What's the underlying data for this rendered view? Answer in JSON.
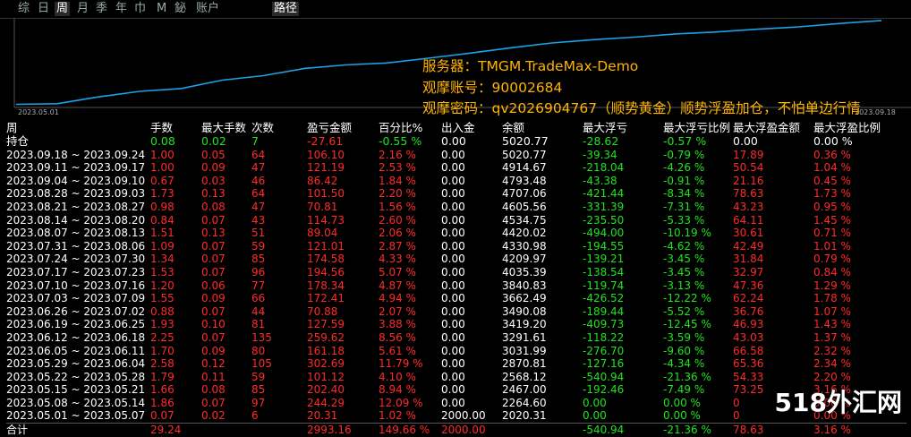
{
  "tabs": [
    {
      "label": "综",
      "active": false
    },
    {
      "label": "日",
      "active": false
    },
    {
      "label": "周",
      "active": true
    },
    {
      "label": "月",
      "active": false
    },
    {
      "label": "季",
      "active": false
    },
    {
      "label": "年",
      "active": false
    },
    {
      "label": "巾",
      "active": false
    },
    {
      "label": "M",
      "active": false
    },
    {
      "label": "鉍",
      "active": false
    },
    {
      "label": "账户",
      "active": false
    }
  ],
  "route_tab": "路径",
  "chart_data": {
    "type": "line",
    "color": "#1aa3e8",
    "x_start_label": "2023.05.01",
    "x_end_label": "2023.09.18",
    "points": [
      2000,
      2020,
      2265,
      2467,
      2568,
      2871,
      3032,
      3292,
      3419,
      3490,
      3662,
      3841,
      4035,
      4210,
      4331,
      4420,
      4535,
      4606,
      4707,
      4793,
      4915,
      5021
    ]
  },
  "overlay": {
    "server": "服务器：TMGM.TradeMax-Demo",
    "account": "观摩账号：90002684",
    "password": "观摩密码：qv2026904767（顺势黄金）顺势浮盈加仓，不怕单边行情"
  },
  "headers": [
    "周",
    "手数",
    "最大手数",
    "次数",
    "盈亏金额",
    "百分比%",
    "出入金",
    "余额",
    "最大浮亏",
    "最大浮亏比例",
    "最大浮盈金额",
    "最大浮盈比例"
  ],
  "held": {
    "label": "持仓",
    "lots": "0.08",
    "max_lots": "0.02",
    "count": "7",
    "pnl": "-27.61",
    "pct": "-0.55 %",
    "io": "0.00",
    "balance": "5020.77",
    "max_dd": "-28.62",
    "max_dd_pct": "-0.57 %",
    "max_fp": "0.00",
    "max_fp_pct": "0.00 %"
  },
  "rows": [
    {
      "week": "2023.09.18 ~ 2023.09.24",
      "lots": "1.00",
      "max_lots": "0.05",
      "count": "64",
      "pnl": "106.10",
      "pct": "2.16 %",
      "io": "0.00",
      "balance": "5020.77",
      "max_dd": "-39.34",
      "max_dd_pct": "-0.79 %",
      "max_fp": "17.89",
      "max_fp_pct": "0.36 %"
    },
    {
      "week": "2023.09.11 ~ 2023.09.17",
      "lots": "1.00",
      "max_lots": "0.09",
      "count": "47",
      "pnl": "121.19",
      "pct": "2.53 %",
      "io": "0.00",
      "balance": "4914.67",
      "max_dd": "-218.04",
      "max_dd_pct": "-4.26 %",
      "max_fp": "50.54",
      "max_fp_pct": "1.04 %"
    },
    {
      "week": "2023.09.04 ~ 2023.09.10",
      "lots": "0.67",
      "max_lots": "0.03",
      "count": "46",
      "pnl": "86.42",
      "pct": "1.84 %",
      "io": "0.00",
      "balance": "4793.48",
      "max_dd": "-43.38",
      "max_dd_pct": "-0.91 %",
      "max_fp": "21.16",
      "max_fp_pct": "0.45 %"
    },
    {
      "week": "2023.08.28 ~ 2023.09.03",
      "lots": "1.73",
      "max_lots": "0.13",
      "count": "64",
      "pnl": "101.50",
      "pct": "2.20 %",
      "io": "0.00",
      "balance": "4707.06",
      "max_dd": "-421.44",
      "max_dd_pct": "-8.34 %",
      "max_fp": "78.63",
      "max_fp_pct": "1.73 %"
    },
    {
      "week": "2023.08.21 ~ 2023.08.27",
      "lots": "0.98",
      "max_lots": "0.08",
      "count": "47",
      "pnl": "70.81",
      "pct": "1.56 %",
      "io": "0.00",
      "balance": "4605.56",
      "max_dd": "-331.39",
      "max_dd_pct": "-7.31 %",
      "max_fp": "43.23",
      "max_fp_pct": "0.95 %"
    },
    {
      "week": "2023.08.14 ~ 2023.08.20",
      "lots": "0.84",
      "max_lots": "0.07",
      "count": "43",
      "pnl": "114.73",
      "pct": "2.60 %",
      "io": "0.00",
      "balance": "4534.75",
      "max_dd": "-235.50",
      "max_dd_pct": "-5.33 %",
      "max_fp": "64.11",
      "max_fp_pct": "1.45 %"
    },
    {
      "week": "2023.08.07 ~ 2023.08.13",
      "lots": "1.51",
      "max_lots": "0.13",
      "count": "51",
      "pnl": "89.04",
      "pct": "2.06 %",
      "io": "0.00",
      "balance": "4420.02",
      "max_dd": "-494.00",
      "max_dd_pct": "-10.19 %",
      "max_fp": "30.61",
      "max_fp_pct": "0.71 %"
    },
    {
      "week": "2023.07.31 ~ 2023.08.06",
      "lots": "1.09",
      "max_lots": "0.07",
      "count": "59",
      "pnl": "121.01",
      "pct": "2.87 %",
      "io": "0.00",
      "balance": "4330.98",
      "max_dd": "-194.55",
      "max_dd_pct": "-4.62 %",
      "max_fp": "42.49",
      "max_fp_pct": "1.01 %"
    },
    {
      "week": "2023.07.24 ~ 2023.07.30",
      "lots": "1.34",
      "max_lots": "0.07",
      "count": "85",
      "pnl": "174.58",
      "pct": "4.33 %",
      "io": "0.00",
      "balance": "4209.97",
      "max_dd": "-139.21",
      "max_dd_pct": "-3.45 %",
      "max_fp": "31.84",
      "max_fp_pct": "0.79 %"
    },
    {
      "week": "2023.07.17 ~ 2023.07.23",
      "lots": "1.53",
      "max_lots": "0.07",
      "count": "96",
      "pnl": "194.56",
      "pct": "5.07 %",
      "io": "0.00",
      "balance": "4035.39",
      "max_dd": "-138.54",
      "max_dd_pct": "-3.45 %",
      "max_fp": "32.97",
      "max_fp_pct": "0.84 %"
    },
    {
      "week": "2023.07.10 ~ 2023.07.16",
      "lots": "1.20",
      "max_lots": "0.06",
      "count": "77",
      "pnl": "178.34",
      "pct": "4.87 %",
      "io": "0.00",
      "balance": "3840.83",
      "max_dd": "-119.74",
      "max_dd_pct": "-3.13 %",
      "max_fp": "47.36",
      "max_fp_pct": "1.29 %"
    },
    {
      "week": "2023.07.03 ~ 2023.07.09",
      "lots": "1.55",
      "max_lots": "0.09",
      "count": "66",
      "pnl": "172.41",
      "pct": "4.94 %",
      "io": "0.00",
      "balance": "3662.49",
      "max_dd": "-426.52",
      "max_dd_pct": "-12.22 %",
      "max_fp": "62.24",
      "max_fp_pct": "1.78 %"
    },
    {
      "week": "2023.06.26 ~ 2023.07.02",
      "lots": "0.88",
      "max_lots": "0.07",
      "count": "44",
      "pnl": "70.88",
      "pct": "2.07 %",
      "io": "0.00",
      "balance": "3490.08",
      "max_dd": "-189.44",
      "max_dd_pct": "-5.52 %",
      "max_fp": "36.76",
      "max_fp_pct": "1.07 %"
    },
    {
      "week": "2023.06.19 ~ 2023.06.25",
      "lots": "1.93",
      "max_lots": "0.10",
      "count": "81",
      "pnl": "127.59",
      "pct": "3.88 %",
      "io": "0.00",
      "balance": "3419.20",
      "max_dd": "-409.73",
      "max_dd_pct": "-12.45 %",
      "max_fp": "46.93",
      "max_fp_pct": "1.43 %"
    },
    {
      "week": "2023.06.12 ~ 2023.06.18",
      "lots": "2.25",
      "max_lots": "0.07",
      "count": "135",
      "pnl": "259.62",
      "pct": "8.56 %",
      "io": "0.00",
      "balance": "3291.61",
      "max_dd": "-118.22",
      "max_dd_pct": "-3.59 %",
      "max_fp": "43.03",
      "max_fp_pct": "1.37 %"
    },
    {
      "week": "2023.06.05 ~ 2023.06.11",
      "lots": "1.70",
      "max_lots": "0.09",
      "count": "80",
      "pnl": "161.18",
      "pct": "5.61 %",
      "io": "0.00",
      "balance": "3031.99",
      "max_dd": "-276.70",
      "max_dd_pct": "-9.60 %",
      "max_fp": "66.58",
      "max_fp_pct": "2.32 %"
    },
    {
      "week": "2023.05.29 ~ 2023.06.04",
      "lots": "2.58",
      "max_lots": "0.12",
      "count": "105",
      "pnl": "302.69",
      "pct": "11.79 %",
      "io": "0.00",
      "balance": "2870.81",
      "max_dd": "-127.16",
      "max_dd_pct": "-4.34 %",
      "max_fp": "65.36",
      "max_fp_pct": "2.34 %"
    },
    {
      "week": "2023.05.22 ~ 2023.05.28",
      "lots": "1.79",
      "max_lots": "0.11",
      "count": "59",
      "pnl": "101.12",
      "pct": "4.10 %",
      "io": "0.00",
      "balance": "2568.12",
      "max_dd": "-540.94",
      "max_dd_pct": "-21.36 %",
      "max_fp": "54.33",
      "max_fp_pct": "2.20 %"
    },
    {
      "week": "2023.05.15 ~ 2023.05.21",
      "lots": "1.66",
      "max_lots": "0.08",
      "count": "85",
      "pnl": "202.40",
      "pct": "8.94 %",
      "io": "0.00",
      "balance": "2467.00",
      "max_dd": "-192.46",
      "max_dd_pct": "-7.49 %",
      "max_fp": "73.25",
      "max_fp_pct": "3.16 %"
    },
    {
      "week": "2023.05.08 ~ 2023.05.14",
      "lots": "1.86",
      "max_lots": "0.07",
      "count": "97",
      "pnl": "244.29",
      "pct": "12.09 %",
      "io": "0.00",
      "balance": "2264.60",
      "max_dd": "0.00",
      "max_dd_pct": "0.00 %",
      "max_fp": "0",
      "max_fp_pct": "0.00 %"
    },
    {
      "week": "2023.05.01 ~ 2023.05.07",
      "lots": "0.07",
      "max_lots": "0.02",
      "count": "6",
      "pnl": "20.31",
      "pct": "1.02 %",
      "io": "2000.00",
      "balance": "2020.31",
      "max_dd": "0.00",
      "max_dd_pct": "0.00 %",
      "max_fp": "0",
      "max_fp_pct": "0.00 %"
    }
  ],
  "total": {
    "label": "合计",
    "lots": "29.24",
    "max_lots": "",
    "count": "",
    "pnl": "2993.16",
    "pct": "149.66 %",
    "io": "2000.00",
    "balance": "",
    "max_dd": "-540.94",
    "max_dd_pct": "-21.36 %",
    "max_fp": "78.63",
    "max_fp_pct": "3.16 %"
  },
  "watermark": "518外汇网"
}
